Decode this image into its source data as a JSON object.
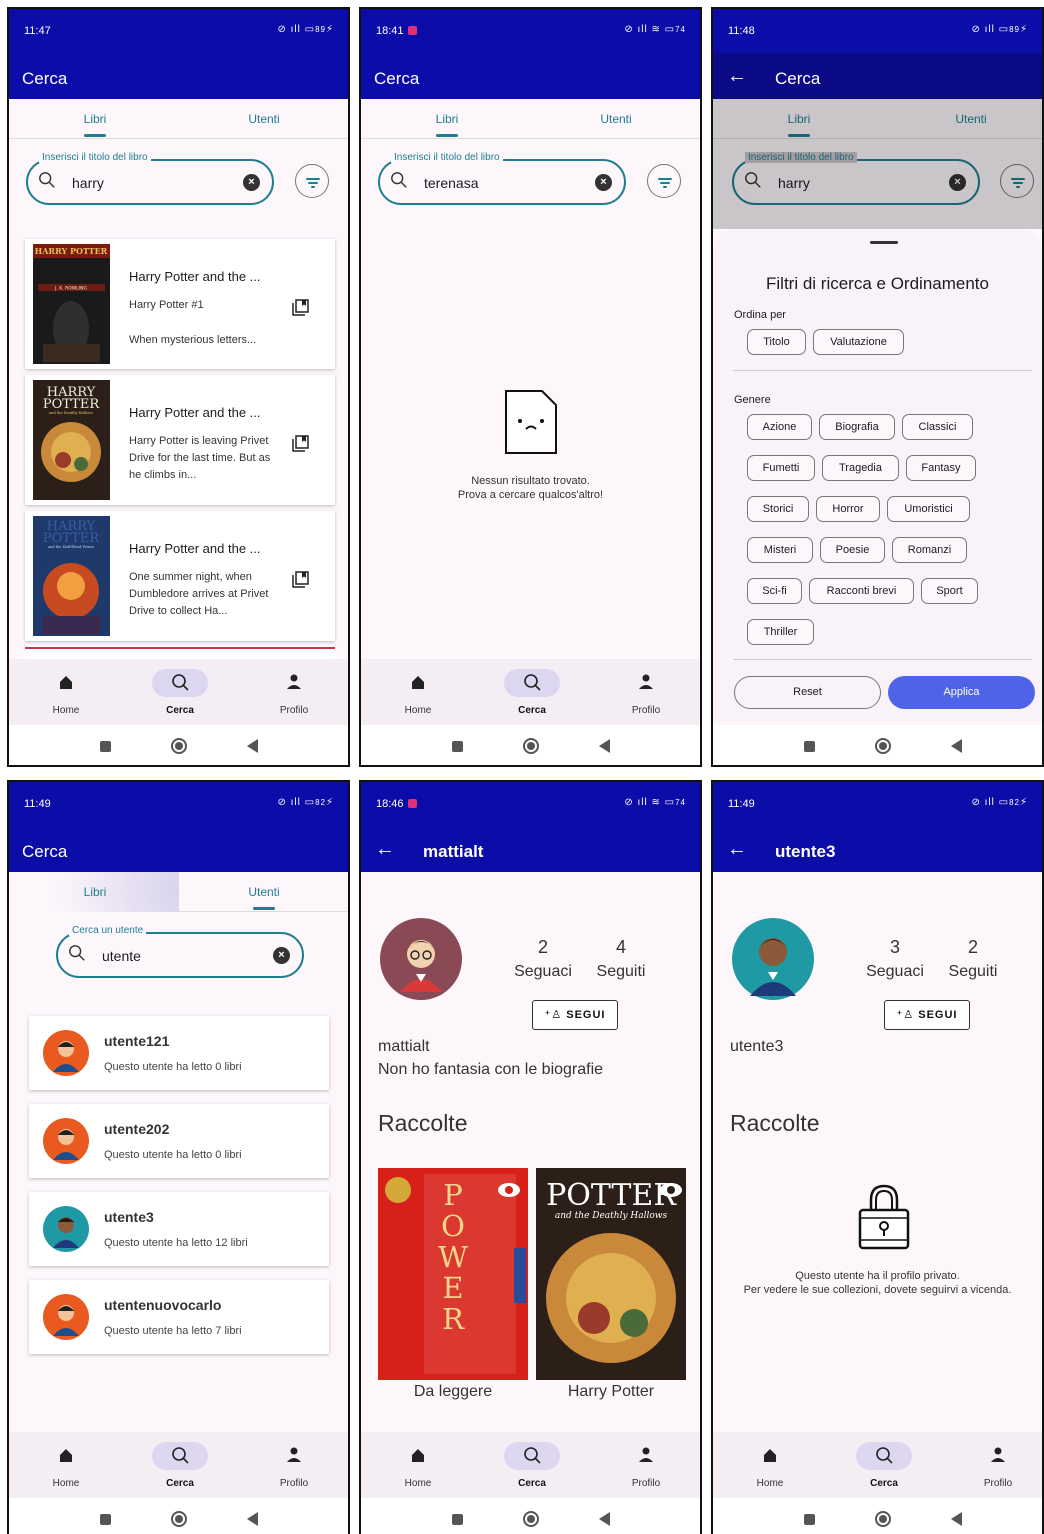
{
  "common": {
    "cerca": "Cerca",
    "tab_libri": "Libri",
    "tab_utenti": "Utenti",
    "nav_home": "Home",
    "nav_cerca": "Cerca",
    "nav_profilo": "Profilo",
    "segui": "SEGUI",
    "seguaci": "Seguaci",
    "seguiti": "Seguiti",
    "raccolte": "Raccolte",
    "search_book_label": "Inserisci il titolo del libro",
    "search_user_label": "Cerca un utente"
  },
  "screen1": {
    "time": "11:47",
    "battery": "89",
    "search_value": "harry",
    "books": [
      {
        "title": "Harry Potter and the ...",
        "desc": "Harry Potter #1",
        "desc2": "When mysterious letters..."
      },
      {
        "title": "Harry Potter and the ...",
        "desc": "Harry Potter is leaving Privet Drive for the last time. But as he climbs in..."
      },
      {
        "title": "Harry Potter and the ...",
        "desc": "One summer night, when Dumbledore arrives at Privet Drive to collect Ha..."
      }
    ]
  },
  "screen2": {
    "time": "18:41",
    "battery": "74",
    "search_value": "terenasa",
    "empty_line1": "Nessun risultato trovato.",
    "empty_line2": "Prova a cercare qualcos'altro!"
  },
  "screen3": {
    "time": "11:48",
    "battery": "89",
    "search_value": "harry",
    "sheet_title": "Filtri di ricerca e Ordinamento",
    "order_label": "Ordina per",
    "order_options": [
      "Titolo",
      "Valutazione"
    ],
    "genre_label": "Genere",
    "genres": [
      "Azione",
      "Biografia",
      "Classici",
      "Fumetti",
      "Tragedia",
      "Fantasy",
      "Storici",
      "Horror",
      "Umoristici",
      "Misteri",
      "Poesie",
      "Romanzi",
      "Sci-fi",
      "Racconti brevi",
      "Sport",
      "Thriller"
    ],
    "reset": "Reset",
    "apply": "Applica"
  },
  "screen4": {
    "time": "11:49",
    "battery": "82",
    "search_value": "utente",
    "users": [
      {
        "name": "utente121",
        "count": "Questo utente ha letto 0 libri"
      },
      {
        "name": "utente202",
        "count": "Questo utente ha letto 0 libri"
      },
      {
        "name": "utente3",
        "count": "Questo utente ha letto 12 libri"
      },
      {
        "name": "utentenuovocarlo",
        "count": "Questo utente ha letto 7 libri"
      }
    ]
  },
  "screen5": {
    "time": "18:46",
    "battery": "74",
    "title": "mattialt",
    "followers": "2",
    "following": "4",
    "username": "mattialt",
    "bio": "Non ho fantasia con le biografie",
    "collections": [
      {
        "name": "Da leggere",
        "cover_letters": [
          "P",
          "O",
          "W",
          "E",
          "R"
        ]
      },
      {
        "name": "Harry Potter",
        "cover_title": "HARRY POTTER",
        "cover_sub": "and the Deathly Hallows"
      }
    ]
  },
  "screen6": {
    "time": "11:49",
    "battery": "82",
    "title": "utente3",
    "followers": "3",
    "following": "2",
    "username": "utente3",
    "private_line1": "Questo utente ha il profilo privato.",
    "private_line2": "Per vedere le sue collezioni, dovete seguirvi a vicenda."
  },
  "book_covers": [
    {
      "top_text": "HARRY POTTER",
      "author": "J. K. ROWLING"
    },
    {
      "top_text": "HARRY POTTER",
      "sub": "and the Deathly Hallows"
    },
    {
      "top_text": "HARRY POTTER",
      "sub": "and the Half-Blood Prince"
    }
  ],
  "colors": {
    "appbar": "#0c0ca8",
    "accent": "#1e7f8f",
    "apply": "#4f63e8",
    "background": "#fdf7fc"
  }
}
